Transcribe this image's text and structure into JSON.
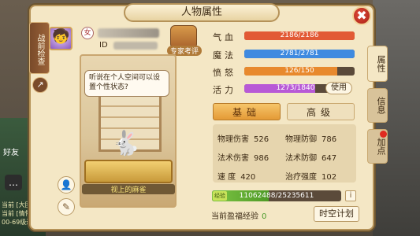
{
  "window": {
    "title": "人物属性",
    "close_icon": "✖"
  },
  "left_tab": {
    "label": "战前检查"
  },
  "character": {
    "id_label": "ID",
    "expert_label": "专家考评",
    "speech": "听说在个人空间可以设置个性状态?",
    "pet_name": "视上的麻雀"
  },
  "bars": [
    {
      "label": "气血",
      "text": "2186/2186",
      "value": 2186,
      "max": 2186,
      "color": "#e25a35"
    },
    {
      "label": "魔法",
      "text": "2781/2781",
      "value": 2781,
      "max": 2781,
      "color": "#3f8ae0"
    },
    {
      "label": "愤怒",
      "text": "126/150",
      "value": 126,
      "max": 150,
      "color": "#e8892d"
    },
    {
      "label": "活力",
      "text": "1273/1840",
      "value": 1273,
      "max": 1840,
      "color": "#b859d6"
    }
  ],
  "use_button": "使用",
  "tabs": {
    "basic": "基础",
    "advanced": "高级"
  },
  "stats": {
    "phys_atk_label": "物理伤害",
    "phys_atk": "526",
    "phys_def_label": "物理防御",
    "phys_def": "786",
    "mag_atk_label": "法术伤害",
    "mag_atk": "986",
    "mag_def_label": "法术防御",
    "mag_def": "647",
    "speed_label": "速 度",
    "speed": "420",
    "heal_label": "治疗强度",
    "heal": "102"
  },
  "experience": {
    "icon_text": "经验",
    "text": "11062488/25235611",
    "value": 11062488,
    "max": 25235611
  },
  "surplus": {
    "label": "当前盈福经验",
    "value": "0"
  },
  "plan_button": "时空计划",
  "right_tabs": [
    "属性",
    "信息",
    "加点"
  ],
  "background": {
    "friend": "好友",
    "lines": [
      "当前 [大团",
      "当前 [情怀",
      "00-69级进组"
    ]
  }
}
